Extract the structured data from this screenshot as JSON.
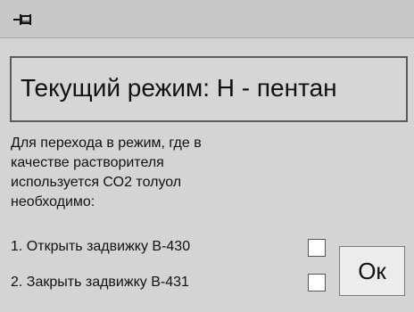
{
  "titlebar": {
    "icon": "pin-icon"
  },
  "mode": {
    "text": "Текущий режим: Н - пентан"
  },
  "instruction": {
    "lines": [
      "Для перехода в режим, где в",
      "качестве растворителя",
      "используется СО2 толуол",
      "необходимо:"
    ]
  },
  "steps": [
    {
      "label": "1. Открыть задвижку В-430",
      "checked": false
    },
    {
      "label": "2. Закрыть задвижку В-431",
      "checked": false
    }
  ],
  "ok_button": {
    "label": "Ок"
  },
  "colors": {
    "window_bg": "#d4d4d4",
    "titlebar_bg": "#c8c8c8",
    "border": "#5a5a5a"
  }
}
